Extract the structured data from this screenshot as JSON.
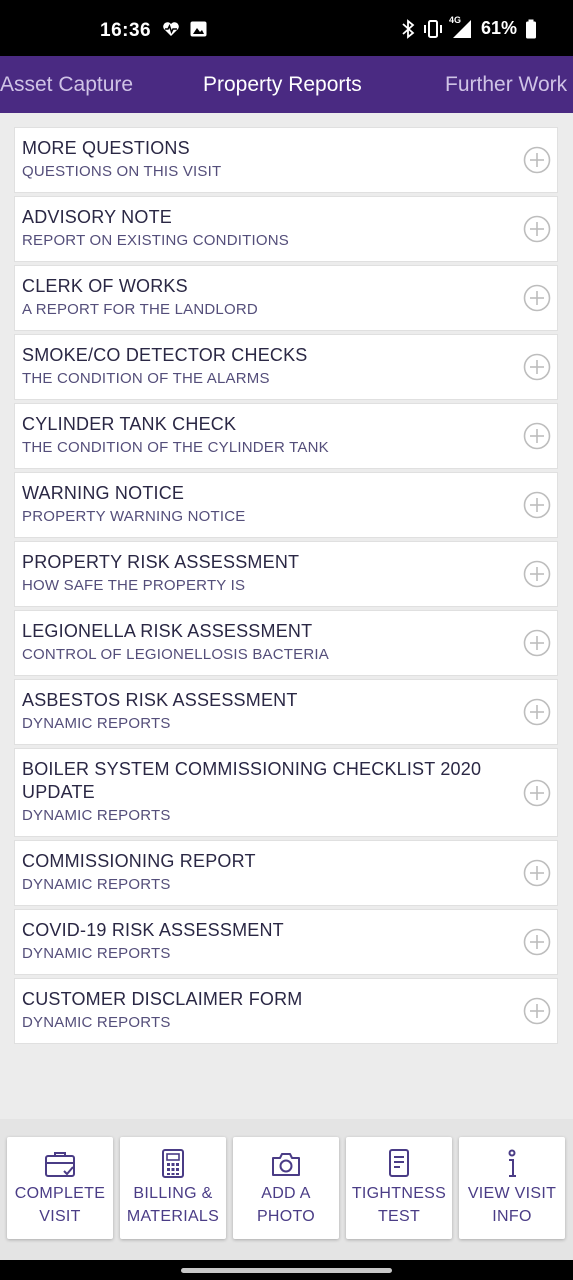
{
  "status_bar": {
    "time": "16:36",
    "battery": "61%",
    "network": "4G"
  },
  "tabs": [
    {
      "label": "Asset Capture"
    },
    {
      "label": "Property Reports"
    },
    {
      "label": "Further Work"
    }
  ],
  "reports": [
    {
      "title": "MORE QUESTIONS",
      "subtitle": "QUESTIONS ON THIS VISIT"
    },
    {
      "title": "ADVISORY NOTE",
      "subtitle": "REPORT ON EXISTING CONDITIONS"
    },
    {
      "title": "CLERK OF WORKS",
      "subtitle": "A REPORT FOR THE LANDLORD"
    },
    {
      "title": "SMOKE/CO DETECTOR CHECKS",
      "subtitle": "THE CONDITION OF THE ALARMS"
    },
    {
      "title": "CYLINDER TANK CHECK",
      "subtitle": "THE CONDITION OF THE CYLINDER TANK"
    },
    {
      "title": "WARNING NOTICE",
      "subtitle": "PROPERTY WARNING NOTICE"
    },
    {
      "title": "PROPERTY RISK ASSESSMENT",
      "subtitle": "HOW SAFE THE PROPERTY IS"
    },
    {
      "title": "LEGIONELLA RISK ASSESSMENT",
      "subtitle": "CONTROL OF LEGIONELLOSIS BACTERIA"
    },
    {
      "title": "ASBESTOS RISK ASSESSMENT",
      "subtitle": "DYNAMIC REPORTS"
    },
    {
      "title": "BOILER SYSTEM COMMISSIONING CHECKLIST 2020 UPDATE",
      "subtitle": "DYNAMIC REPORTS"
    },
    {
      "title": "COMMISSIONING REPORT",
      "subtitle": "DYNAMIC REPORTS"
    },
    {
      "title": "COVID-19 RISK ASSESSMENT",
      "subtitle": "DYNAMIC REPORTS"
    },
    {
      "title": "CUSTOMER DISCLAIMER FORM",
      "subtitle": "DYNAMIC REPORTS"
    }
  ],
  "actions": [
    {
      "line1": "COMPLETE",
      "line2": "VISIT",
      "icon": "briefcase-check-icon"
    },
    {
      "line1": "BILLING &",
      "line2": "MATERIALS",
      "icon": "calculator-icon"
    },
    {
      "line1": "ADD A",
      "line2": "PHOTO",
      "icon": "camera-icon"
    },
    {
      "line1": "TIGHTNESS",
      "line2": "TEST",
      "icon": "document-icon"
    },
    {
      "line1": "VIEW VISIT",
      "line2": "INFO",
      "icon": "info-icon"
    }
  ],
  "colors": {
    "header": "#4a2a82",
    "accent_text": "#4a3c86",
    "plus_icon": "#bdbdbd"
  }
}
